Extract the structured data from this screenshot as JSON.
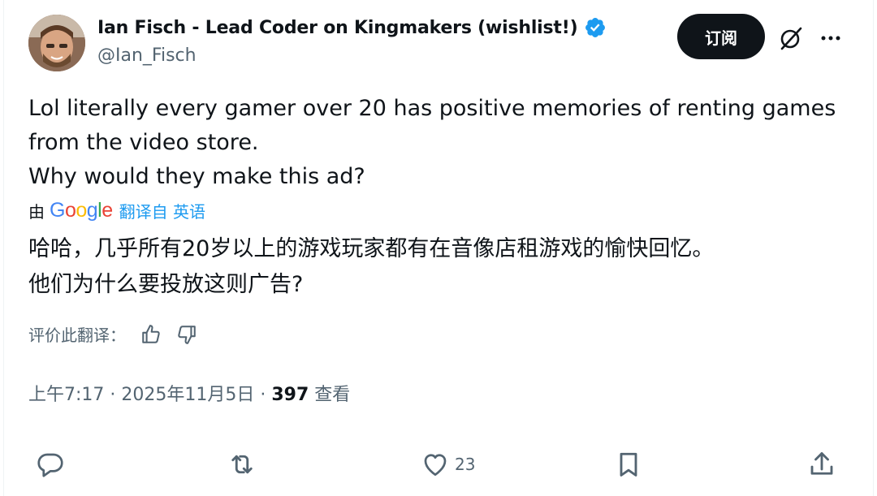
{
  "author": {
    "name": "Ian Fisch - Lead Coder on Kingmakers (wishlist!)",
    "handle": "@Ian_Fisch",
    "verified_icon": "verified-badge-icon"
  },
  "header": {
    "subscribe_label": "订阅",
    "grok_icon": "grok-icon",
    "more_icon": "more-icon"
  },
  "tweet": {
    "lines": [
      "Lol literally every gamer over 20 has positive memories of renting games from the video store.",
      "Why would they make this ad?"
    ]
  },
  "translation": {
    "by_label": "由",
    "google_label": "Google",
    "translated_from": "翻译自 英语",
    "lines": [
      "哈哈，几乎所有20岁以上的游戏玩家都有在音像店租游戏的愉快回忆。",
      "他们为什么要投放这则广告?"
    ],
    "rate_label": "评价此翻译："
  },
  "meta": {
    "time": "上午7:17",
    "sep1": " · ",
    "date": "2025年11月5日",
    "sep2": " · ",
    "views_count": "397",
    "views_label": " 查看"
  },
  "actions": {
    "like_count": "23"
  },
  "colors": {
    "text": "#0f1419",
    "secondary": "#536471",
    "accent": "#1d9bf0",
    "button_bg": "#0f1419"
  }
}
